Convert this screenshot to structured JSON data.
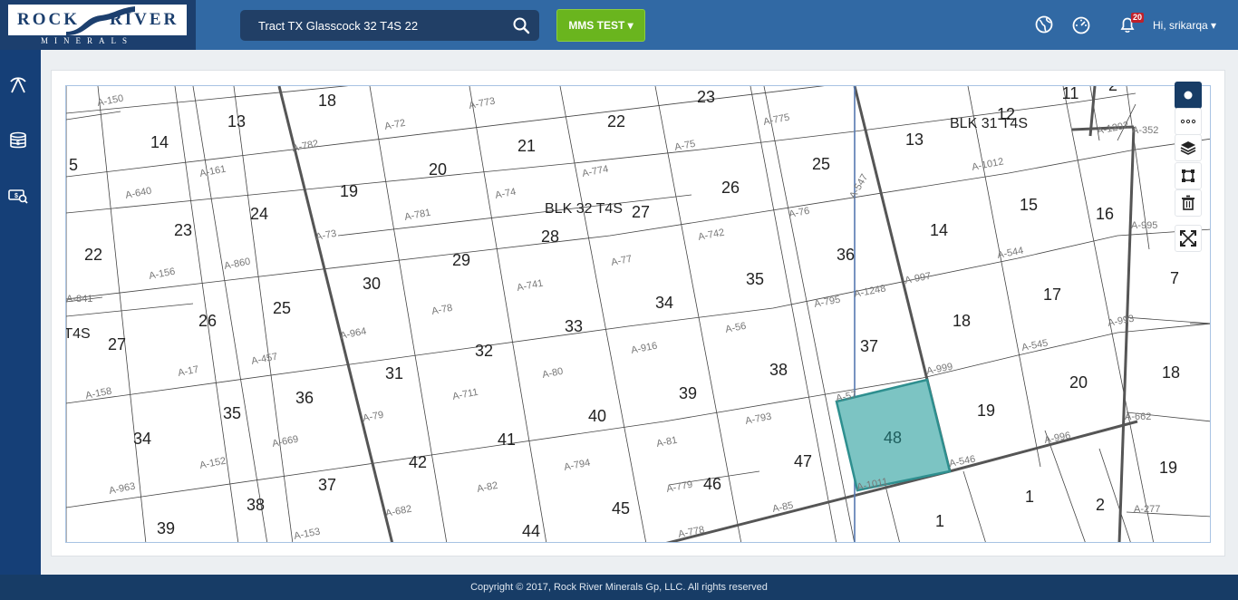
{
  "brand": {
    "name_left": "ROCK",
    "name_right": "RIVER",
    "tagline": "MINERALS"
  },
  "search": {
    "value": "Tract TX Glasscock 32 T4S 22",
    "icon": "search-icon"
  },
  "mms_button": {
    "label": "MMS TEST"
  },
  "header": {
    "icons": [
      "globe-icon",
      "dashboard-gauge-icon",
      "bell-icon"
    ],
    "notification_count": "20",
    "user_greeting": "Hi, srikarqa"
  },
  "sidebar": {
    "items": [
      {
        "icon": "pickaxe-icon"
      },
      {
        "icon": "money-stack-icon"
      },
      {
        "icon": "money-search-icon"
      }
    ]
  },
  "map": {
    "selected_section": "48",
    "selected_fill": "#7cc4c3",
    "block_labels": [
      {
        "text": "BLK 32 T4S"
      },
      {
        "text": "BLK 31 T4S"
      },
      {
        "text": "T4S"
      }
    ],
    "sections": [
      "5",
      "14",
      "13",
      "18",
      "20",
      "21",
      "22",
      "23",
      "25",
      "13",
      "12",
      "11",
      "2",
      "22",
      "23",
      "24",
      "19",
      "28",
      "27",
      "26",
      "15",
      "16",
      "7",
      "26",
      "25",
      "30",
      "29",
      "34",
      "35",
      "36",
      "14",
      "17",
      "27",
      "36",
      "31",
      "32",
      "33",
      "38",
      "37",
      "18",
      "18",
      "35",
      "34",
      "42",
      "41",
      "40",
      "39",
      "47",
      "48",
      "19",
      "20",
      "19",
      "38",
      "37",
      "44",
      "45",
      "46",
      "1",
      "1",
      "2",
      "39",
      "27"
    ],
    "abstracts": [
      "A-150",
      "A-773",
      "A-72",
      "A-775",
      "A-782",
      "A-75",
      "A-1202",
      "A-352",
      "A-161",
      "A-640",
      "A-774",
      "A-74",
      "A-1012",
      "A-781",
      "A-76",
      "A-547",
      "A-995",
      "A-73",
      "A-742",
      "A-156",
      "A-860",
      "A-77",
      "A-544",
      "A-741",
      "A-841",
      "A-78",
      "A-997",
      "A-795",
      "A-1248",
      "A-56",
      "A-993",
      "A-964",
      "A-916",
      "A-545",
      "A-17",
      "A-457",
      "A-80",
      "A-711",
      "A-158",
      "A-999",
      "A-79",
      "A-57",
      "A-793",
      "A-669",
      "A-81",
      "A-662",
      "A-996",
      "A-152",
      "A-794",
      "A-546",
      "A-963",
      "A-82",
      "A-779",
      "A-85",
      "A-1011",
      "A-682",
      "A-778",
      "A-153",
      "A-277"
    ]
  },
  "map_tools": [
    {
      "icon": "point-draw-icon"
    },
    {
      "icon": "more-options-icon"
    },
    {
      "icon": "layers-icon"
    },
    {
      "icon": "polygon-draw-icon"
    },
    {
      "icon": "trash-icon"
    },
    {
      "icon": "fullscreen-icon"
    }
  ],
  "footer": {
    "copyright": "Copyright © 2017, Rock River Minerals Gp, LLC. All rights reserved"
  }
}
